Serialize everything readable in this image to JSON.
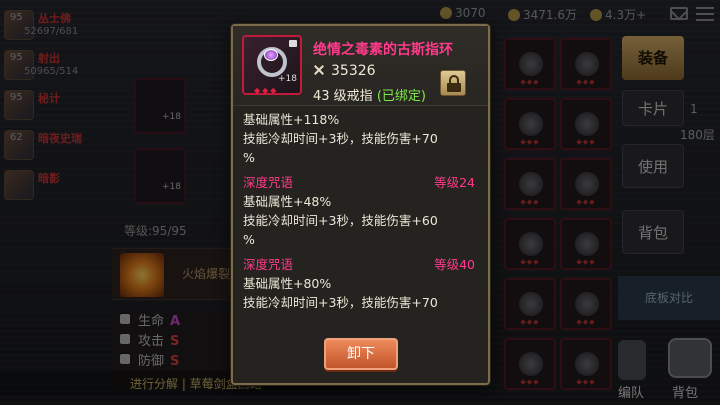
{
  "topbar": {
    "currencies": [
      "3070",
      "3471.6万",
      "4.3万+"
    ]
  },
  "party": [
    {
      "name": "丛士佛",
      "hp": "52697/681",
      "lv": "95"
    },
    {
      "name": "射出",
      "hp": "50965/514",
      "lv": "95"
    },
    {
      "name": "秘计",
      "hp": "",
      "lv": "95"
    },
    {
      "name": "暗夜史瑞",
      "hp": "",
      "lv": "62"
    },
    {
      "name": "暗影",
      "hp": "",
      "lv": ""
    }
  ],
  "char_panel": {
    "slot_plus_1": "+18",
    "slot_plus_2": "+18",
    "level": "等级:95/95",
    "skill_name": "火焰爆裂",
    "stats": [
      {
        "label": "生命",
        "grade": "A"
      },
      {
        "label": "攻击",
        "grade": "S"
      },
      {
        "label": "防御",
        "grade": "S"
      }
    ],
    "chat": "进行分解 | 草莓剑盒回路"
  },
  "bag": {
    "cells": [
      {
        "pips": "◆◆◆"
      },
      {
        "pips": "◆◆◆"
      },
      {
        "pips": "◆◆◆"
      },
      {
        "pips": "◆◆◆"
      },
      {
        "pips": "◆◆◆"
      },
      {
        "pips": "◆◆◆"
      },
      {
        "pips": "◆◆◆"
      },
      {
        "pips": "◆◆◆"
      },
      {
        "pips": "◆◆◆"
      },
      {
        "pips": "◆◆◆"
      },
      {
        "pips": "◆◆◆"
      },
      {
        "pips": "◆◆◆"
      }
    ]
  },
  "actions": {
    "equip": "装备",
    "card": "卡片",
    "use": "使用",
    "bag": "背包",
    "compare": "底板对比",
    "count": "1",
    "floor": "180层",
    "team": "编队",
    "bag_nav": "背包"
  },
  "popup": {
    "item_name": "绝情之毒素的古斯指环",
    "icon_plus": "+18",
    "icon_pips": "◆◆◆",
    "power": "35326",
    "type_prefix": "43 级戒指",
    "bound": "(已绑定)",
    "blocks": [
      {
        "title": "",
        "level": "",
        "lines": [
          "基础属性+118%",
          "技能冷却时间+3秒，技能伤害+70",
          "%"
        ]
      },
      {
        "title": "深度咒语",
        "level": "等级24",
        "lines": [
          "基础属性+48%",
          "技能冷却时间+3秒，技能伤害+60",
          "%"
        ]
      },
      {
        "title": "深度咒语",
        "level": "等级40",
        "lines": [
          "基础属性+80%",
          "技能冷却时间+3秒，技能伤害+70"
        ]
      }
    ],
    "unequip": "卸下"
  },
  "colors": {
    "item_name": "#ff3a8a",
    "bound": "#7fe84a",
    "accent_button": "#e07a4a",
    "equip_button": "#d6b06a"
  }
}
